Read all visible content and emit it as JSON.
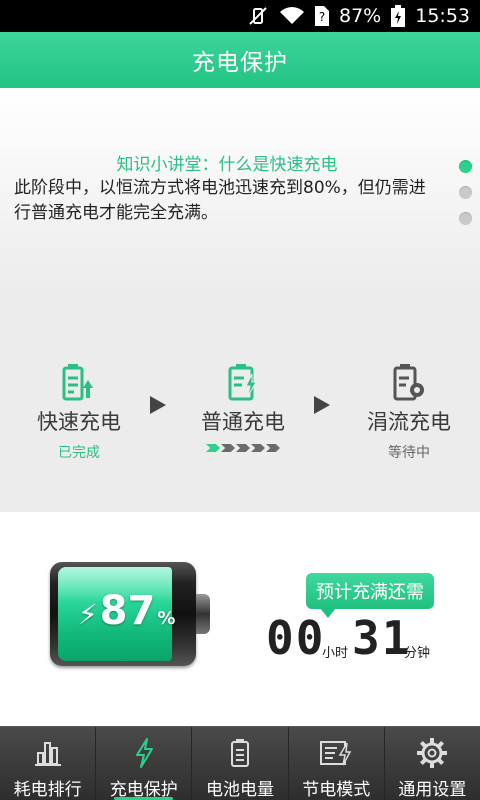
{
  "status_bar": {
    "battery_percent": "87%",
    "time": "15:53"
  },
  "header": {
    "title": "充电保护"
  },
  "tips": {
    "title": "知识小讲堂：什么是快速充电",
    "body": "此阶段中，以恒流方式将电池迅速充到80%，但仍需进行普通充电才能完全充满。",
    "pages": 3,
    "active_page": 1
  },
  "stages": [
    {
      "label": "快速充电",
      "status": "已完成",
      "icon": "battery-fast-charge-icon"
    },
    {
      "label": "普通充电",
      "status": "",
      "progress": "1/5",
      "icon": "battery-normal-charge-icon"
    },
    {
      "label": "涓流充电",
      "status": "等待中",
      "icon": "battery-trickle-charge-icon"
    }
  ],
  "battery": {
    "percent": "87",
    "percent_sign": "%",
    "level": 0.87
  },
  "remaining": {
    "badge": "预计充满还需",
    "hours": "00",
    "hours_unit": "小时",
    "minutes": "31",
    "minutes_unit": "分钟"
  },
  "nav": {
    "items": [
      {
        "label": "耗电排行",
        "icon": "bar-chart-icon"
      },
      {
        "label": "充电保护",
        "icon": "lightning-icon",
        "active": true
      },
      {
        "label": "电池电量",
        "icon": "battery-icon"
      },
      {
        "label": "节电模式",
        "icon": "power-save-mode-icon"
      },
      {
        "label": "通用设置",
        "icon": "gear-icon"
      }
    ]
  },
  "colors": {
    "accent": "#22c383",
    "status_bar": "#000000",
    "nav_background": "#3a3a3a"
  }
}
